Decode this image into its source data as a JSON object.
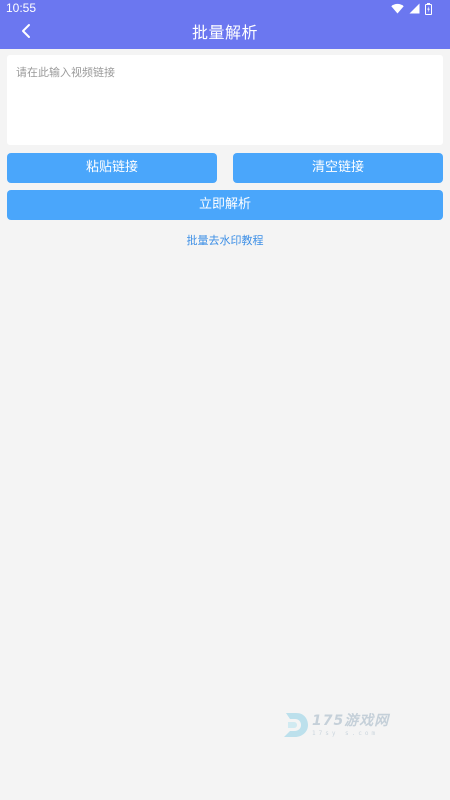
{
  "status_bar": {
    "time": "10:55",
    "icons": [
      "wifi-icon",
      "signal-icon",
      "battery-icon"
    ]
  },
  "app_bar": {
    "back_icon": "chevron-left-icon",
    "title": "批量解析"
  },
  "link_input": {
    "placeholder": "请在此输入视频链接",
    "value": ""
  },
  "buttons": {
    "paste_label": "粘贴链接",
    "clear_label": "清空链接",
    "parse_label": "立即解析"
  },
  "tutorial_link": "批量去水印教程",
  "watermark": {
    "brand": "175游戏网",
    "domain": "17sy s.com"
  },
  "colors": {
    "primary": "#6b77f0",
    "button": "#4aa6fb",
    "link": "#3d8fe6",
    "background": "#f4f4f4"
  }
}
